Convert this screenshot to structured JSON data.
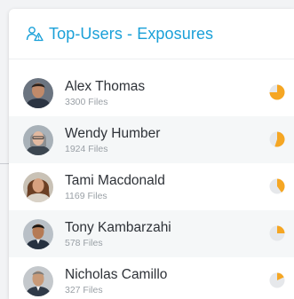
{
  "widget": {
    "title": "Top-Users - Exposures",
    "icon": "users-alert-icon"
  },
  "users": [
    {
      "name": "Alex Thomas",
      "files": "3300 Files",
      "exposure": 0.75,
      "color": "#f5a623"
    },
    {
      "name": "Wendy Humber",
      "files": "1924 Files",
      "exposure": 0.55,
      "color": "#f5a623"
    },
    {
      "name": "Tami Macdonald",
      "files": "1169 Files",
      "exposure": 0.4,
      "color": "#f5a623"
    },
    {
      "name": "Tony Kambarzahi",
      "files": "578 Files",
      "exposure": 0.25,
      "color": "#f5a623"
    },
    {
      "name": "Nicholas Camillo",
      "files": "327 Files",
      "exposure": 0.18,
      "color": "#f5a623"
    }
  ]
}
